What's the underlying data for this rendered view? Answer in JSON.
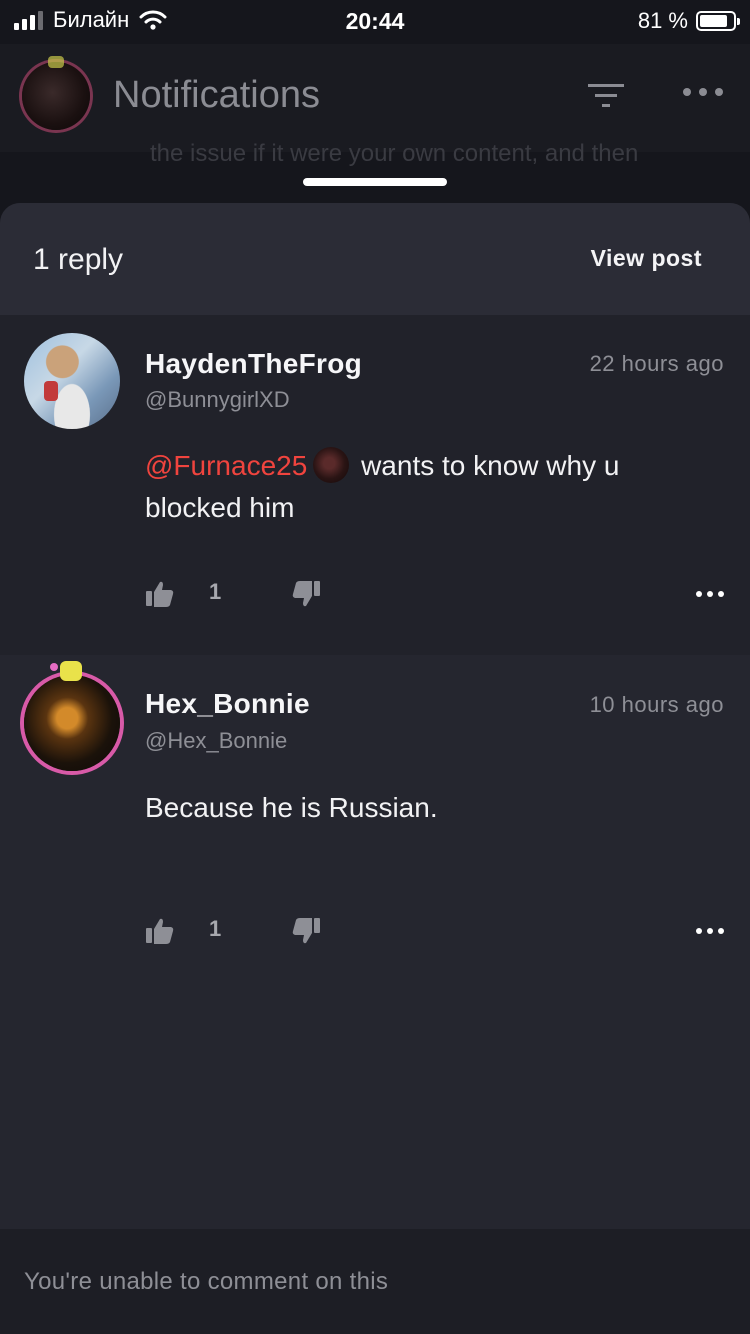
{
  "status_bar": {
    "carrier": "Билайн",
    "time": "20:44",
    "battery_percent": "81 %",
    "battery_level": 0.81,
    "signal_bars": 3
  },
  "header": {
    "title": "Notifications",
    "ghost_text": "the issue if it were your own content, and then"
  },
  "sheet": {
    "reply_count": "1 reply",
    "view_post_label": "View post"
  },
  "comments": [
    {
      "name": "HaydenTheFrog",
      "handle": "@BunnygirlXD",
      "time": "22 hours ago",
      "mention": "@Furnace25",
      "text": "wants to know why u blocked him",
      "likes": "1"
    },
    {
      "name": "Hex_Bonnie",
      "handle": "@Hex_Bonnie",
      "time": "10 hours ago",
      "text": "Because he is Russian.",
      "likes": "1"
    }
  ],
  "footer": {
    "text": "You're unable to comment on this"
  },
  "colors": {
    "mention": "#f0443e",
    "background": "#25262f",
    "avatar_ring": "#d85aa8"
  },
  "icons": [
    "signal-icon",
    "wifi-icon",
    "battery-icon",
    "filter-icon",
    "more-icon",
    "thumb-up-icon",
    "thumb-down-icon"
  ]
}
